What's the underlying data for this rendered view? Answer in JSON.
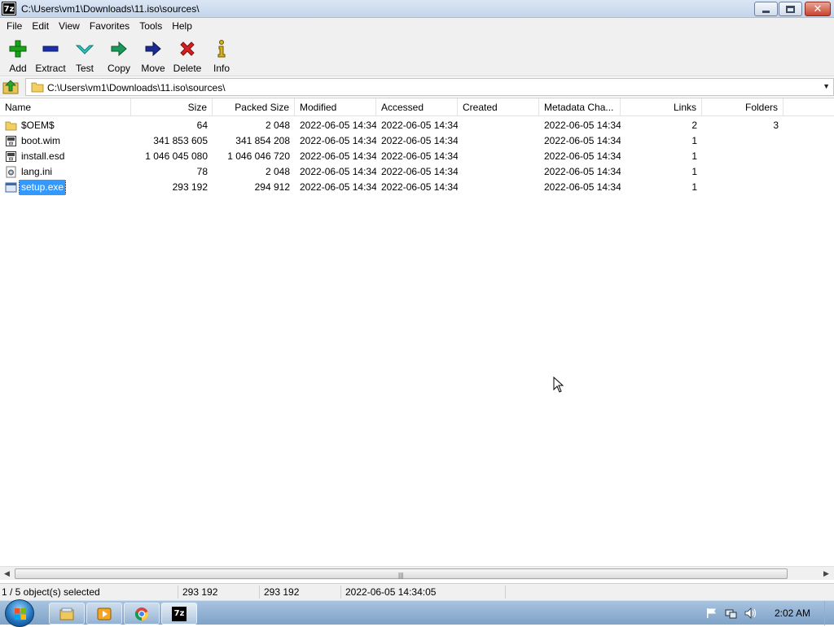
{
  "window": {
    "title": "C:\\Users\\vm1\\Downloads\\11.iso\\sources\\",
    "app_icon_text": "7z"
  },
  "menu": [
    "File",
    "Edit",
    "View",
    "Favorites",
    "Tools",
    "Help"
  ],
  "toolbar": {
    "add": "Add",
    "extract": "Extract",
    "test": "Test",
    "copy": "Copy",
    "move": "Move",
    "delete": "Delete",
    "info": "Info"
  },
  "address": {
    "path": "C:\\Users\\vm1\\Downloads\\11.iso\\sources\\"
  },
  "columns": {
    "name": "Name",
    "size": "Size",
    "packed_size": "Packed Size",
    "modified": "Modified",
    "accessed": "Accessed",
    "created": "Created",
    "metadata_changed": "Metadata Cha...",
    "links": "Links",
    "folders": "Folders"
  },
  "files": [
    {
      "name": "$OEM$",
      "type": "folder",
      "size": "64",
      "packed": "2 048",
      "modified": "2022-06-05 14:34",
      "accessed": "2022-06-05 14:34",
      "created": "",
      "metadata": "2022-06-05 14:34",
      "links": "2",
      "folders": "3",
      "selected": false
    },
    {
      "name": "boot.wim",
      "type": "archive",
      "size": "341 853 605",
      "packed": "341 854 208",
      "modified": "2022-06-05 14:34",
      "accessed": "2022-06-05 14:34",
      "created": "",
      "metadata": "2022-06-05 14:34",
      "links": "1",
      "folders": "",
      "selected": false
    },
    {
      "name": "install.esd",
      "type": "archive",
      "size": "1 046 045 080",
      "packed": "1 046 046 720",
      "modified": "2022-06-05 14:34",
      "accessed": "2022-06-05 14:34",
      "created": "",
      "metadata": "2022-06-05 14:34",
      "links": "1",
      "folders": "",
      "selected": false
    },
    {
      "name": "lang.ini",
      "type": "settings",
      "size": "78",
      "packed": "2 048",
      "modified": "2022-06-05 14:34",
      "accessed": "2022-06-05 14:34",
      "created": "",
      "metadata": "2022-06-05 14:34",
      "links": "1",
      "folders": "",
      "selected": false
    },
    {
      "name": "setup.exe",
      "type": "application",
      "size": "293 192",
      "packed": "294 912",
      "modified": "2022-06-05 14:34",
      "accessed": "2022-06-05 14:34",
      "created": "",
      "metadata": "2022-06-05 14:34",
      "links": "1",
      "folders": "",
      "selected": true
    }
  ],
  "status": {
    "selection": "1 / 5 object(s) selected",
    "size": "293 192",
    "packed": "293 192",
    "modified": "2022-06-05 14:34:05"
  },
  "taskbar": {
    "apps": [
      "explorer-icon",
      "media-player-icon",
      "chrome-icon",
      "7zip-icon"
    ],
    "active_app_text": "7z",
    "clock": "2:02 AM"
  },
  "colors": {
    "selection": "#3399ff",
    "titlebar": "#c4d5ea",
    "taskbar": "#8fb0d4",
    "close_button": "#c8432d"
  }
}
